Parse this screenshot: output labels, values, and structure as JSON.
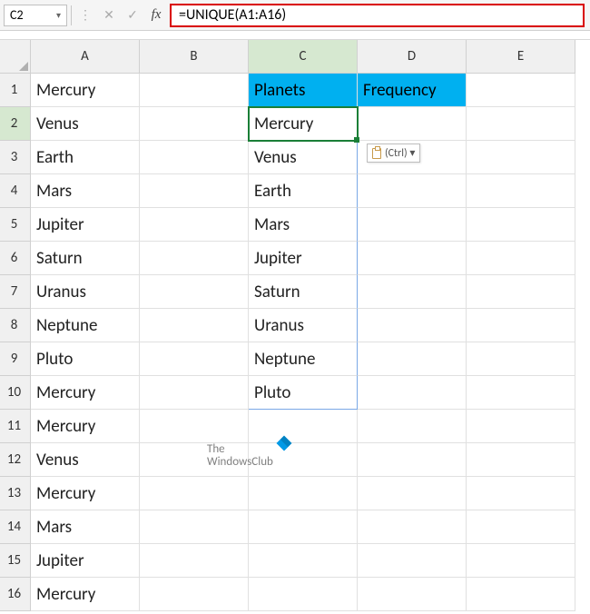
{
  "formula_bar": {
    "name_box": "C2",
    "formula": "=UNIQUE(A1:A16)"
  },
  "columns": [
    "A",
    "B",
    "C",
    "D",
    "E"
  ],
  "rows": [
    "1",
    "2",
    "3",
    "4",
    "5",
    "6",
    "7",
    "8",
    "9",
    "10",
    "11",
    "12",
    "13",
    "14",
    "15",
    "16"
  ],
  "col_a": [
    "Mercury",
    "Venus",
    "Earth",
    "Mars",
    "Jupiter",
    "Saturn",
    "Uranus",
    "Neptune",
    "Pluto",
    "Mercury",
    "Mercury",
    "Venus",
    "Mercury",
    "Mars",
    "Jupiter",
    "Mercury"
  ],
  "headers": {
    "c1": "Planets",
    "d1": "Frequency"
  },
  "spill_c": [
    "Mercury",
    "Venus",
    "Earth",
    "Mars",
    "Jupiter",
    "Saturn",
    "Uranus",
    "Neptune",
    "Pluto"
  ],
  "paste_tag": "(Ctrl) ▾",
  "watermark": {
    "line1": "The",
    "line2": "WindowsClub"
  },
  "active_cell": "C2",
  "chart_data": {
    "type": "table",
    "title": "Excel worksheet with UNIQUE formula",
    "columns": [
      "A",
      "B",
      "C",
      "D",
      "E"
    ],
    "data_A": [
      "Mercury",
      "Venus",
      "Earth",
      "Mars",
      "Jupiter",
      "Saturn",
      "Uranus",
      "Neptune",
      "Pluto",
      "Mercury",
      "Mercury",
      "Venus",
      "Mercury",
      "Mars",
      "Jupiter",
      "Mercury"
    ],
    "data_C_header": "Planets",
    "data_D_header": "Frequency",
    "data_C_spill": [
      "Mercury",
      "Venus",
      "Earth",
      "Mars",
      "Jupiter",
      "Saturn",
      "Uranus",
      "Neptune",
      "Pluto"
    ],
    "formula_in_C2": "=UNIQUE(A1:A16)"
  }
}
